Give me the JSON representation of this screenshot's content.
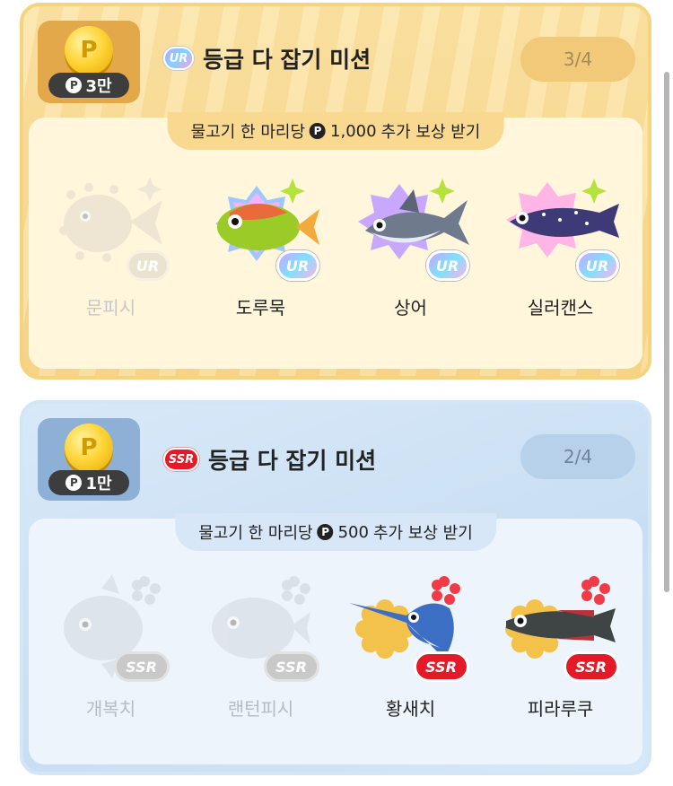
{
  "missions": [
    {
      "grade": "UR",
      "title": "등급 다 잡기 미션",
      "reward_amount": "3만",
      "reward_currency_symbol": "P",
      "progress": "3/4",
      "subtitle_pre": "물고기 한 마리당",
      "subtitle_amount": "1,000",
      "subtitle_post": "추가 보상 받기",
      "fish": [
        {
          "name": "문피시",
          "caught": false,
          "badge": "UR"
        },
        {
          "name": "도루묵",
          "caught": true,
          "badge": "UR"
        },
        {
          "name": "상어",
          "caught": true,
          "badge": "UR"
        },
        {
          "name": "실러캔스",
          "caught": true,
          "badge": "UR"
        }
      ]
    },
    {
      "grade": "SSR",
      "title": "등급 다 잡기 미션",
      "reward_amount": "1만",
      "reward_currency_symbol": "P",
      "progress": "2/4",
      "subtitle_pre": "물고기 한 마리당",
      "subtitle_amount": "500",
      "subtitle_post": "추가 보상 받기",
      "fish": [
        {
          "name": "개복치",
          "caught": false,
          "badge": "SSR"
        },
        {
          "name": "랜턴피시",
          "caught": false,
          "badge": "SSR"
        },
        {
          "name": "황새치",
          "caught": true,
          "badge": "SSR"
        },
        {
          "name": "피라루쿠",
          "caught": true,
          "badge": "SSR"
        }
      ]
    }
  ],
  "colors": {
    "ur_card": "#f8d98f",
    "ssr_card": "#cfe3f6",
    "ssr_red": "#e51a28",
    "star_green": "#b5e23c",
    "flower_red": "#ef3b46"
  },
  "icons": [
    "coin-icon",
    "ur-badge-icon",
    "ssr-badge-icon",
    "sparkle-star-icon",
    "flower-icon",
    "fish-icon"
  ]
}
